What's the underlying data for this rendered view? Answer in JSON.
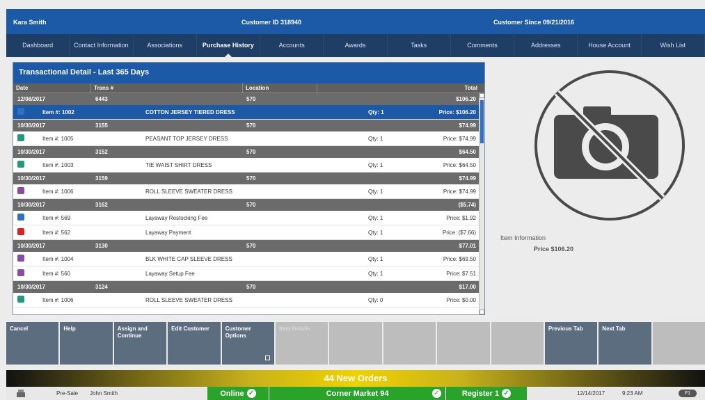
{
  "header": {
    "customer_name": "Kara Smith",
    "customer_id": "Customer ID 318940",
    "customer_since": "Customer Since 09/21/2016"
  },
  "tabs": [
    {
      "label": "Dashboard",
      "active": false
    },
    {
      "label": "Contact Information",
      "active": false
    },
    {
      "label": "Associations",
      "active": false
    },
    {
      "label": "Purchase History",
      "active": true
    },
    {
      "label": "Accounts",
      "active": false
    },
    {
      "label": "Awards",
      "active": false
    },
    {
      "label": "Tasks",
      "active": false
    },
    {
      "label": "Comments",
      "active": false
    },
    {
      "label": "Addresses",
      "active": false
    },
    {
      "label": "House Account",
      "active": false
    },
    {
      "label": "Wish List",
      "active": false
    }
  ],
  "panel": {
    "title": "Transactional Detail - Last 365 Days",
    "columns": {
      "date": "Date",
      "trans": "Trans #",
      "location": "Location",
      "total": "Total"
    }
  },
  "rows": [
    {
      "type": "group",
      "date": "12/08/2017",
      "trans": "6443",
      "location": "570",
      "total": "$106.20"
    },
    {
      "type": "item",
      "icon": "blue",
      "item_no": "Item #: 1002",
      "name": "COTTON JERSEY TIERED DRESS",
      "qty": "Qty: 1",
      "price": "Price: $106.20",
      "selected": true
    },
    {
      "type": "group",
      "date": "10/30/2017",
      "trans": "3155",
      "location": "570",
      "total": "$74.99"
    },
    {
      "type": "item",
      "icon": "teal",
      "item_no": "Item #: 1005",
      "name": "PEASANT TOP JERSEY DRESS",
      "qty": "Qty: 1",
      "price": "Price: $74.99"
    },
    {
      "type": "group",
      "date": "10/30/2017",
      "trans": "3152",
      "location": "570",
      "total": "$64.50"
    },
    {
      "type": "item",
      "icon": "teal",
      "item_no": "Item #: 1003",
      "name": "TIE WAIST SHIRT DRESS",
      "qty": "Qty: 1",
      "price": "Price: $64.50"
    },
    {
      "type": "group",
      "date": "10/30/2017",
      "trans": "3159",
      "location": "570",
      "total": "$74.99"
    },
    {
      "type": "item",
      "icon": "purple",
      "item_no": "Item #: 1006",
      "name": "ROLL SLEEVE SWEATER DRESS",
      "qty": "Qty: 1",
      "price": "Price: $74.99"
    },
    {
      "type": "group",
      "date": "10/30/2017",
      "trans": "3162",
      "location": "570",
      "total": "($5.74)"
    },
    {
      "type": "item",
      "icon": "blue",
      "item_no": "Item #: 569",
      "name": "Layaway Restocking Fee",
      "qty": "Qty: 1",
      "price": "Price: $1.92"
    },
    {
      "type": "item",
      "icon": "red",
      "item_no": "Item #: 562",
      "name": "Layaway Payment",
      "qty": "Qty: 1",
      "price": "Price: ($7.66)"
    },
    {
      "type": "group",
      "date": "10/30/2017",
      "trans": "3130",
      "location": "570",
      "total": "$77.01"
    },
    {
      "type": "item",
      "icon": "purple",
      "item_no": "Item #: 1004",
      "name": "BLK WHITE CAP SLEEVE DRESS",
      "qty": "Qty: 1",
      "price": "Price: $69.50"
    },
    {
      "type": "item",
      "icon": "purple",
      "item_no": "Item #: 560",
      "name": "Layaway Setup Fee",
      "qty": "Qty: 1",
      "price": "Price: $7.51"
    },
    {
      "type": "group",
      "date": "10/30/2017",
      "trans": "3124",
      "location": "570",
      "total": "$17.00"
    },
    {
      "type": "item",
      "icon": "teal",
      "item_no": "Item #: 1006",
      "name": "ROLL SLEEVE SWEATER DRESS",
      "qty": "Qty: 0",
      "price": "Price: $0.00"
    }
  ],
  "item_info": {
    "label": "Item Information",
    "price": "Price $106.20"
  },
  "function_buttons": [
    {
      "label": "Cancel",
      "enabled": true
    },
    {
      "label": "Help",
      "enabled": true
    },
    {
      "label": "Assign and Continue",
      "enabled": true
    },
    {
      "label": "Edit Customer",
      "enabled": true
    },
    {
      "label": "Customer Options",
      "enabled": true
    },
    {
      "label": "Item Details",
      "enabled": false
    },
    {
      "label": "",
      "enabled": false
    },
    {
      "label": "",
      "enabled": false
    },
    {
      "label": "",
      "enabled": false
    },
    {
      "label": "",
      "enabled": false
    },
    {
      "label": "Previous Tab",
      "enabled": true
    },
    {
      "label": "Next Tab",
      "enabled": true
    },
    {
      "label": "",
      "enabled": false
    }
  ],
  "orders_banner": "44 New Orders",
  "status": {
    "mode": "Pre-Sale",
    "user": "John Smith",
    "online": "Online",
    "market": "Corner Market 94",
    "register": "Register 1",
    "date": "12/14/2017",
    "time": "9:23 AM",
    "pill": "F1"
  },
  "colors": {
    "accent": "#1c5aa8",
    "nav": "#1f3e66",
    "online": "#2aa32a",
    "group_row": "#6b6b6b"
  }
}
